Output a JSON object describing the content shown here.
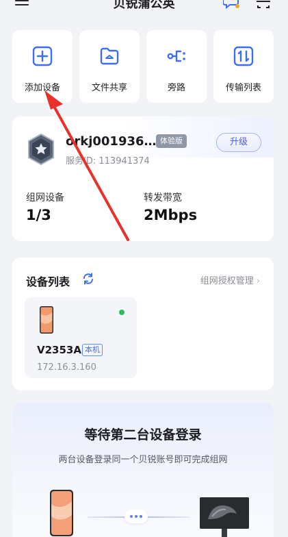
{
  "header": {
    "title": "贝锐蒲公英",
    "menu_icon": "hamburger-icon",
    "right_icons": [
      "chat-icon",
      "scan-icon"
    ]
  },
  "quick_actions": [
    {
      "label": "添加设备",
      "icon": "add-device-icon"
    },
    {
      "label": "文件共享",
      "icon": "folder-share-icon"
    },
    {
      "label": "旁路",
      "icon": "bypass-icon"
    },
    {
      "label": "传输列表",
      "icon": "transfer-list-icon"
    }
  ],
  "account": {
    "name": "orkj001936…",
    "badge": "体验版",
    "service_id_label": "服务ID:",
    "service_id": "113941374",
    "upgrade_label": "升级",
    "stats": [
      {
        "label": "组网设备",
        "value": "1/3"
      },
      {
        "label": "转发带宽",
        "value": "2Mbps"
      }
    ]
  },
  "device_list": {
    "title": "设备列表",
    "auth_link": "组网授权管理",
    "devices": [
      {
        "name": "V2353A",
        "badge": "本机",
        "ip": "172.16.3.160",
        "online": true
      }
    ]
  },
  "waiting": {
    "title": "等待第二台设备登录",
    "subtitle": "两台设备登录同一个贝锐账号即可完成组网"
  },
  "colors": {
    "accent": "#4b5df0",
    "online": "#22c35a",
    "annotation": "#e8312a"
  }
}
